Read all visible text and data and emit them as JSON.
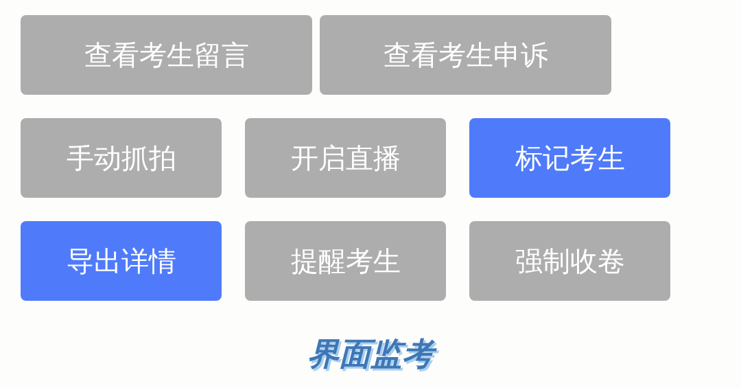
{
  "button_rows": [
    [
      {
        "label": "查看考生留言",
        "selected": false
      },
      {
        "label": "查看考生申诉",
        "selected": false
      }
    ],
    [
      {
        "label": "手动抓拍",
        "selected": false
      },
      {
        "label": "开启直播",
        "selected": false
      },
      {
        "label": "标记考生",
        "selected": true
      }
    ],
    [
      {
        "label": "导出详情",
        "selected": true
      },
      {
        "label": "提醒考生",
        "selected": false
      },
      {
        "label": "强制收卷",
        "selected": false
      }
    ]
  ],
  "caption": "界面监考"
}
